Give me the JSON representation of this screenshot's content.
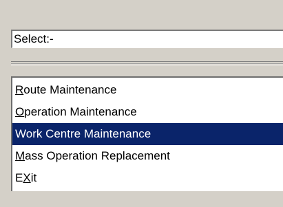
{
  "select_field": {
    "value": "Select:-"
  },
  "menu": {
    "selected_index": 2,
    "items": [
      {
        "accel": "R",
        "rest": "oute Maintenance"
      },
      {
        "accel": "O",
        "rest": "peration Maintenance"
      },
      {
        "accel": "",
        "rest": "Work Centre Maintenance"
      },
      {
        "accel": "M",
        "rest": "ass Operation Replacement"
      },
      {
        "accel": "E",
        "accel_char": "X",
        "rest": "it"
      }
    ]
  },
  "colors": {
    "background": "#d4d0c8",
    "selection": "#0a246a"
  }
}
